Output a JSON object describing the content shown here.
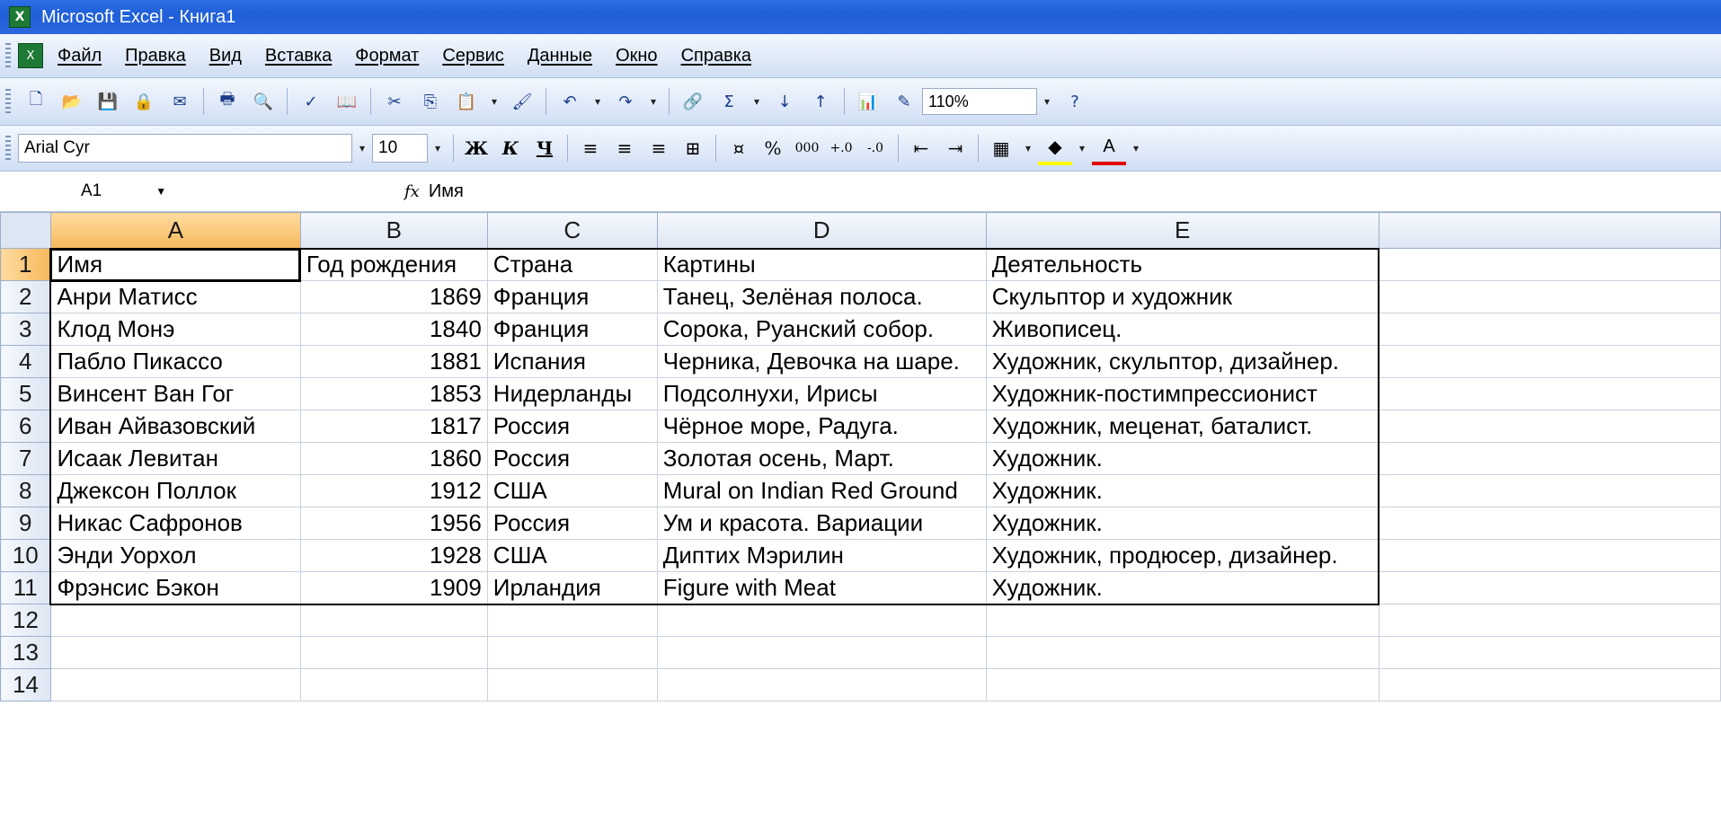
{
  "window": {
    "title": "Microsoft Excel - Книга1",
    "app_icon": "excel-icon"
  },
  "menu": [
    "Файл",
    "Правка",
    "Вид",
    "Вставка",
    "Формат",
    "Сервис",
    "Данные",
    "Окно",
    "Справка"
  ],
  "toolbar": {
    "zoom": "110%"
  },
  "format_bar": {
    "font": "Arial Cyr",
    "size": "10",
    "percent": "%",
    "thousands": "000"
  },
  "formula_bar": {
    "cell_ref": "A1",
    "fx": "fx",
    "value": "Имя"
  },
  "sheet": {
    "columns": [
      "A",
      "B",
      "C",
      "D",
      "E"
    ],
    "rows": [
      {
        "n": "1",
        "a": "Имя",
        "b": "Год рождения",
        "c": "Страна",
        "d": "Картины",
        "e": "Деятельность"
      },
      {
        "n": "2",
        "a": "Анри Матисс",
        "b": "1869",
        "c": "Франция",
        "d": "Танец, Зелёная полоса.",
        "e": "Скульптор и художник"
      },
      {
        "n": "3",
        "a": "Клод Монэ",
        "b": "1840",
        "c": "Франция",
        "d": "Сорока, Руанский собор.",
        "e": "Живописец."
      },
      {
        "n": "4",
        "a": "Пабло Пикассо",
        "b": "1881",
        "c": "Испания",
        "d": "Черника, Девочка на шаре.",
        "e": "Художник, скульптор, дизайнер."
      },
      {
        "n": "5",
        "a": "Винсент Ван Гог",
        "b": "1853",
        "c": "Нидерланды",
        "d": "Подсолнухи, Ирисы",
        "e": "Художник-постимпрессионист"
      },
      {
        "n": "6",
        "a": "Иван Айвазовский",
        "b": "1817",
        "c": "Россия",
        "d": "Чёрное море, Радуга.",
        "e": "Художник, меценат, баталист."
      },
      {
        "n": "7",
        "a": "Исаак Левитан",
        "b": "1860",
        "c": "Россия",
        "d": "Золотая осень, Март.",
        "e": "Художник."
      },
      {
        "n": "8",
        "a": "Джексон Поллок",
        "b": "1912",
        "c": "США",
        "d": "Mural on Indian Red Ground",
        "e": "Художник."
      },
      {
        "n": "9",
        "a": "Никас Сафронов",
        "b": "1956",
        "c": "Россия",
        "d": "Ум и красота. Вариации",
        "e": "Художник."
      },
      {
        "n": "10",
        "a": "Энди Уорхол",
        "b": "1928",
        "c": "США",
        "d": "Диптих Мэрилин",
        "e": "Художник, продюсер, дизайнер."
      },
      {
        "n": "11",
        "a": "Фрэнсис Бэкон",
        "b": "1909",
        "c": "Ирландия",
        "d": "Figure with Meat",
        "e": "Художник."
      },
      {
        "n": "12",
        "a": "",
        "b": "",
        "c": "",
        "d": "",
        "e": ""
      },
      {
        "n": "13",
        "a": "",
        "b": "",
        "c": "",
        "d": "",
        "e": ""
      },
      {
        "n": "14",
        "a": "",
        "b": "",
        "c": "",
        "d": "",
        "e": ""
      }
    ]
  }
}
